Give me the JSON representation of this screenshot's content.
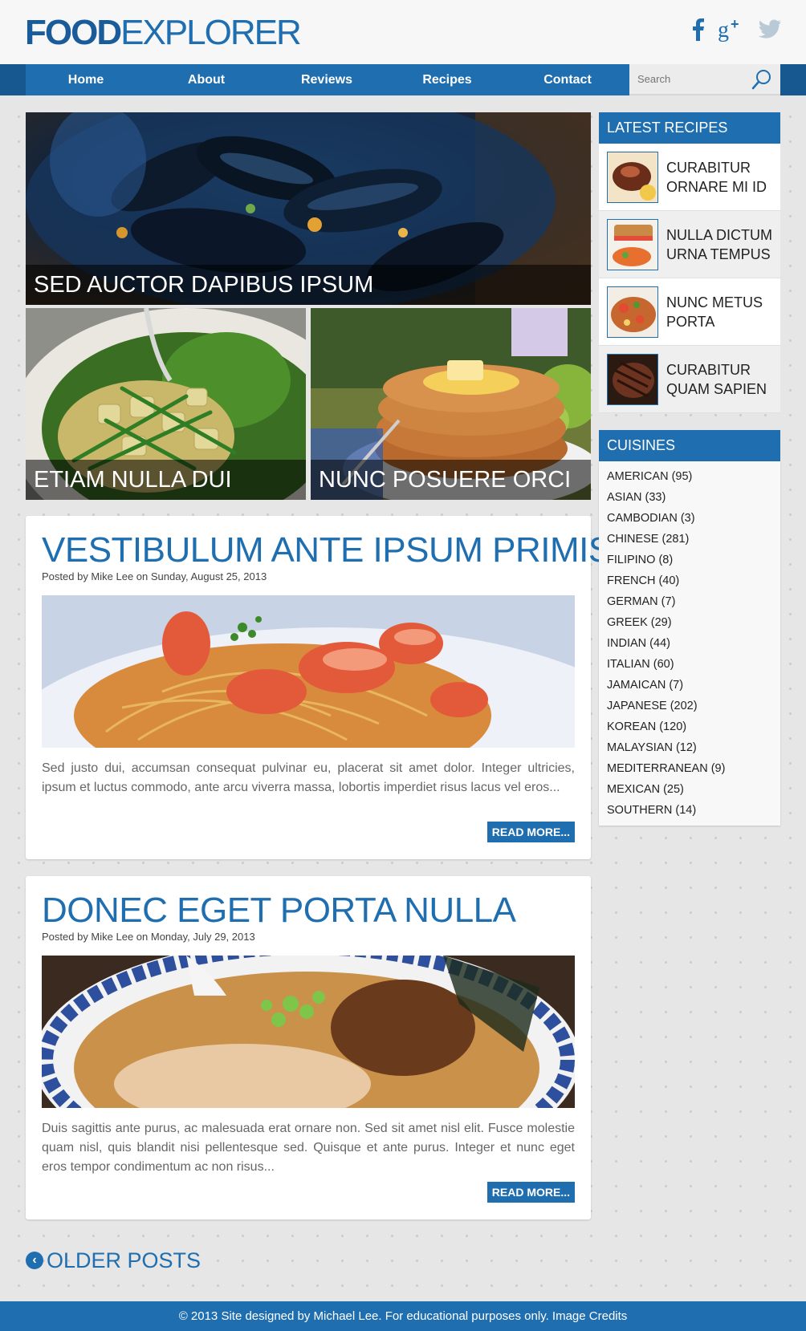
{
  "header": {
    "logo_bold": "FOOD",
    "logo_light": "EXPLORER",
    "social": {
      "facebook": "f",
      "googleplus": "g+",
      "twitter": "🐦"
    }
  },
  "nav": {
    "items": [
      "Home",
      "About",
      "Reviews",
      "Recipes",
      "Contact"
    ],
    "search_placeholder": "Search"
  },
  "featured": {
    "main": {
      "caption": "SED AUCTOR DAPIBUS IPSUM",
      "image": "mussels-photo"
    },
    "left": {
      "caption": "ETIAM NULLA DUI",
      "image": "potato-salad-photo"
    },
    "right": {
      "caption": "NUNC POSUERE ORCI",
      "image": "pancakes-photo"
    }
  },
  "posts": [
    {
      "title": "VESTIBULUM ANTE IPSUM PRIMIS",
      "meta": "Posted by Mike Lee on Sunday, August 25, 2013",
      "image": "shrimp-pasta-photo",
      "excerpt": "Sed justo dui, accumsan consequat pulvinar eu, placerat sit amet dolor. Integer ultricies, ipsum et luctus commodo, ante arcu viverra massa, lobortis imperdiet risus lacus vel eros...",
      "more": "READ MORE..."
    },
    {
      "title": "DONEC EGET PORTA NULLA",
      "meta": "Posted by Mike Lee on Monday, July 29, 2013",
      "image": "ramen-photo",
      "excerpt": "Duis sagittis ante purus, ac malesuada erat ornare non. Sed sit amet nisl elit. Fusce molestie quam nisl, quis blandit nisi pellentesque sed. Quisque et ante purus. Integer et nunc eget eros tempor condimentum ac non risus...",
      "more": "READ MORE..."
    }
  ],
  "sidebar": {
    "latest_title": "LATEST RECIPES",
    "recipes": [
      {
        "title": "CURABITUR ORNARE MI ID",
        "thumb": "steak-thumb"
      },
      {
        "title": "NULLA DICTUM URNA TEMPUS",
        "thumb": "sandwich-thumb"
      },
      {
        "title": "NUNC METUS PORTA",
        "thumb": "stirfry-thumb"
      },
      {
        "title": "CURABITUR QUAM SAPIEN",
        "thumb": "grilled-meat-thumb"
      }
    ],
    "cuisines_title": "CUISINES",
    "cuisines": [
      "AMERICAN (95)",
      "ASIAN (33)",
      "CAMBODIAN (3)",
      "CHINESE (281)",
      "FILIPINO (8)",
      "FRENCH (40)",
      "GERMAN (7)",
      "GREEK (29)",
      "INDIAN (44)",
      "ITALIAN (60)",
      "JAMAICAN (7)",
      "JAPANESE (202)",
      "KOREAN (120)",
      "MALAYSIAN (12)",
      "MEDITERRANEAN (9)",
      "MEXICAN (25)",
      "SOUTHERN (14)"
    ]
  },
  "older_posts": "OLDER POSTS",
  "footer": "© 2013 Site designed by Michael Lee. For educational purposes only. Image Credits",
  "colors": {
    "brand": "#1f6eb0",
    "brand_dark": "#16588f",
    "background": "#e6e6e6"
  }
}
